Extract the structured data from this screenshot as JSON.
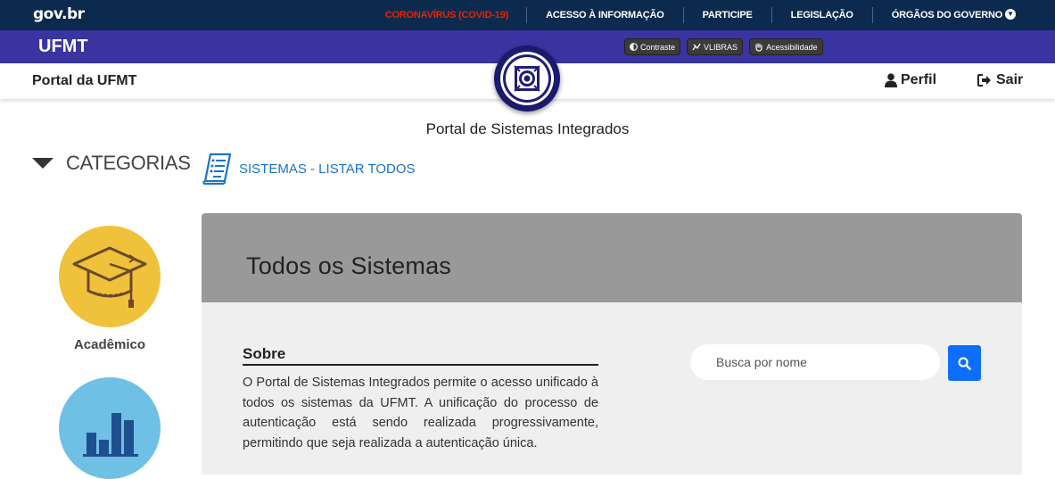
{
  "gov": {
    "logo": "gov.br",
    "links": [
      "CORONAVÍRUS (COVID-19)",
      "ACESSO À INFORMAÇÃO",
      "PARTICIPE",
      "LEGISLAÇÃO",
      "ÓRGÃOS DO GOVERNO"
    ]
  },
  "brand": "UFMT",
  "accessibility": {
    "contraste": "Contraste",
    "vlibras": "VLIBRAS",
    "acessibilidade": "Acessibilidade"
  },
  "header": {
    "portal": "Portal da UFMT",
    "perfil": "Perfil",
    "sair": "Sair"
  },
  "page_title": "Portal de Sistemas Integrados",
  "categorias": "CATEGORIAS",
  "listar_todos": "SISTEMAS - LISTAR TODOS",
  "categories": [
    {
      "label": "Acadêmico",
      "color": "#f0c23c",
      "icon": "graduation-cap-icon"
    },
    {
      "label": "",
      "color": "#6ec1e4",
      "icon": "bar-chart-icon"
    }
  ],
  "panel": {
    "title": "Todos os Sistemas",
    "sobre_title": "Sobre",
    "sobre_text": "O Portal de Sistemas Integrados permite o acesso unificado à todos os sistemas da UFMT. A unificação do processo de autenticação está sendo realizada progressivamente, permitindo que seja realizada a autenticação única."
  },
  "search": {
    "placeholder": "Busca por nome"
  },
  "colors": {
    "gov_bar": "#0c2a4d",
    "ufmt_bar": "#3a34a0",
    "covid": "#e52207",
    "link": "#1a73c8",
    "search_button": "#0d6efd"
  }
}
